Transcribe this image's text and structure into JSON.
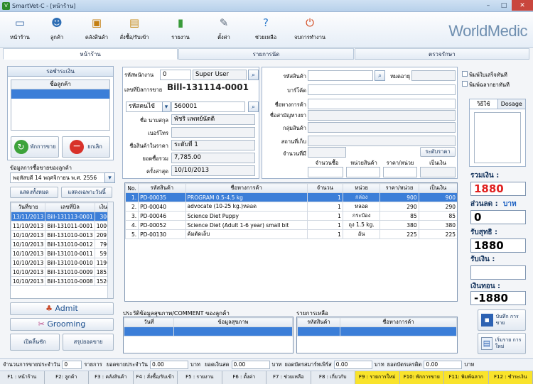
{
  "window": {
    "title": "SmartVet-C - [หน้าร้าน]",
    "min": "–",
    "max": "□",
    "close": "✕"
  },
  "toolbar": {
    "items": [
      {
        "label": "หน้าร้าน",
        "icon": "desktop-icon",
        "glyph": "▭",
        "color": "#3465a4"
      },
      {
        "label": "ลูกค้า",
        "icon": "users-icon",
        "glyph": "☻",
        "color": "#2f6fb5"
      },
      {
        "label": "คลังสินค้า",
        "icon": "warehouse-icon",
        "glyph": "▣",
        "color": "#c47f12"
      },
      {
        "label": "สั่งซื้อ/รับเข้า",
        "icon": "cart-icon",
        "glyph": "▤",
        "color": "#c58b1a"
      },
      {
        "label": "รายงาน",
        "icon": "chart-icon",
        "glyph": "▮",
        "color": "#3a9b3a"
      },
      {
        "label": "ตั้งค่า",
        "icon": "tools-icon",
        "glyph": "✎",
        "color": "#5d6b7c"
      },
      {
        "label": "ช่วยเหลือ",
        "icon": "help-icon",
        "glyph": "?",
        "color": "#2f7ccc"
      },
      {
        "label": "จบการทำงาน",
        "icon": "power-icon",
        "glyph": "⏻",
        "color": "#d2471c"
      }
    ],
    "logo": "WorldMedic"
  },
  "tabs": [
    "หน้าร้าน",
    "รายการนัด",
    "ตรวจรักษา"
  ],
  "queue": {
    "title": "รอชำระเงิน",
    "col_customer": "ชื่อลูกค้า",
    "pause": "พักการขาย",
    "cancel": "ยกเลิก"
  },
  "history": {
    "label": "ข้อมูลการซื้อขายของลูกค้า",
    "date": "พฤหัสบดี 14 พฤศจิกายน พ.ศ. 2556",
    "show_all": "แสดงทั้งหมด",
    "show_today": "แสดงเฉพาะวันนี้",
    "cols": [
      "วันที่ขาย",
      "เลขที่บิล",
      "เงิน"
    ],
    "rows": [
      [
        "13/11/2013",
        "Bill-131113-0001",
        "300"
      ],
      [
        "11/10/2013",
        "Bill-131011-0001",
        "1000"
      ],
      [
        "10/10/2013",
        "Bill-131010-0013",
        "2095"
      ],
      [
        "10/10/2013",
        "Bill-131010-0012",
        "790"
      ],
      [
        "10/10/2013",
        "Bill-131010-0011",
        "595"
      ],
      [
        "10/10/2013",
        "Bill-131010-0010",
        "1190"
      ],
      [
        "10/10/2013",
        "Bill-131010-0009",
        "1855"
      ],
      [
        "10/10/2013",
        "Bill-131010-0008",
        "1520"
      ]
    ]
  },
  "left_buttons": {
    "admit": "Admit",
    "grooming": "Grooming",
    "open_drawer": "เปิดลิ้นชัก",
    "summary": "สรุปยอดขาย"
  },
  "sale": {
    "staff_label": "รหัสพนักงาน",
    "staff_code": "0",
    "staff_name": "Super User",
    "bill_label": "เลขที่บิลการขาย",
    "bill_no": "Bill-131114-0001",
    "cust_code_label": "รหัสคนไข้",
    "cust_code": "560001",
    "name_label": "ชื่อ นามสกุล",
    "name": "พัชริ แพทย์นัดดิ",
    "phone_label": "เบอร์โทร",
    "phone": "",
    "level_label": "ชื่อสินค้าในราคา",
    "level": "ระดับที่ 1",
    "total_label": "ยอดซื้อรวม",
    "total": "7,785.00",
    "last_label": "ครั้งล่าสุด",
    "last": "10/10/2013"
  },
  "product": {
    "code_label": "รหัสสินค้า",
    "expiry_label": "หมดอายุ",
    "barcode_label": "บาร์โค้ด",
    "trade_label": "ชื่อทางการค้า",
    "generic_label": "ชื่อสามัญทางยา",
    "group_label": "กลุ่มสินค้า",
    "location_label": "สถานที่เก็บ",
    "qty_label": "จำนวนที่มี",
    "price_level": "ระดับราคา",
    "h_buy": "จำนวนซื้อ",
    "h_unit": "หน่วยสินค้า",
    "h_price": "ราคา/หน่วย",
    "h_amount": "เป็นเงิน"
  },
  "options": {
    "opt1": "พิมพ์ใบเสร็จทันที",
    "opt2": "พิมพ์ฉลากยาทันที",
    "tab1": "วิธีใช้",
    "tab2": "Dosage"
  },
  "items": {
    "cols": [
      "No.",
      "รหัสสินค้า",
      "ชื่อทางการค้า",
      "จำนวน",
      "หน่วย",
      "ราคา/หน่วย",
      "เป็นเงิน"
    ],
    "rows": [
      [
        "1.",
        "PD-00035",
        "PROGRAM 0.5-4.5 kg",
        "1",
        "กล่อง",
        "900",
        "900"
      ],
      [
        "2.",
        "PD-00040",
        "advocate (10-25 kg.)หลอด",
        "1",
        "หลอด",
        "290",
        "290"
      ],
      [
        "3.",
        "PD-00046",
        "Science Diet Puppy",
        "1",
        "กระป๋อง",
        "85",
        "85"
      ],
      [
        "4.",
        "PD-00052",
        "Science Diet  (Adult 1-6 year) small bit",
        "1",
        "ถุง 1.5 kg.",
        "380",
        "380"
      ],
      [
        "5.",
        "PD-00130",
        "ค้มตัดเล็บ",
        "1",
        "อัน",
        "225",
        "225"
      ]
    ]
  },
  "totals": {
    "sum_label": "รวมเงิน :",
    "sum": "1880",
    "discount_label": "ส่วนลด :",
    "discount_unit": "บาท",
    "discount": "0",
    "net_label": "รับสุทธิ :",
    "net": "1880",
    "received_label": "รับเงิน :",
    "received": "",
    "change_label": "เงินทอน :",
    "change": "-1880"
  },
  "comment": {
    "title": "ประวัติข้อมูลสุขภาพ/COMMENT ของลูกค้า",
    "col_date": "วันที่",
    "col_health": "ข้อมูลสุขภาพ"
  },
  "leftover": {
    "title": "รายการเหลือ",
    "col_code": "รหัสสินค้า",
    "col_name": "ชื่อทางการค้า"
  },
  "actions": {
    "save": "บันทึก การขาย",
    "new": "เริ่มราย การใหม่"
  },
  "status": {
    "count_label": "จำนวนการขายประจำวัน",
    "count": "0",
    "count_unit": "รายการ",
    "sales_label": "ยอดขายประจำวัน",
    "sales": "0.00",
    "baht": "บาท",
    "cash_label": "ยอดเงินสด",
    "cash": "0.00",
    "member_label": "ยอดบัตรสมาร์ทเพิร์ส",
    "member": "0.00",
    "credit_label": "ยอดบัตรเครดิต",
    "credit": "0.00"
  },
  "fkeys": [
    {
      "label": "F1 : หน้าร้าน",
      "hl": false
    },
    {
      "label": "F2: ลูกค้า",
      "hl": false
    },
    {
      "label": "F3 : คลังสินค้า",
      "hl": false
    },
    {
      "label": "F4 : สั่งซื้อ/รับเข้า",
      "hl": false
    },
    {
      "label": "F5 : รายงาน",
      "hl": false
    },
    {
      "label": "F6 : ตั้งค่า",
      "hl": false
    },
    {
      "label": "F7 : ช่วยเหลือ",
      "hl": false
    },
    {
      "label": "F8 : เกี่ยวกับ",
      "hl": false
    },
    {
      "label": "F9 : รายการใหม่",
      "hl": true
    },
    {
      "label": "F10: พักการขาย",
      "hl": true
    },
    {
      "label": "F11: พิมพ์ฉลาก",
      "hl": true
    },
    {
      "label": "F12 : ชำระเงิน",
      "hl": true
    }
  ]
}
